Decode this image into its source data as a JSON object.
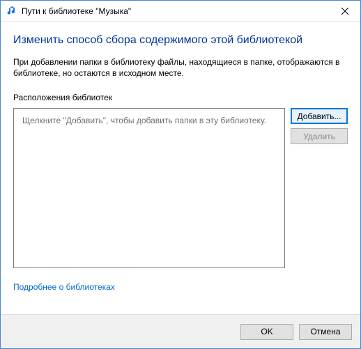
{
  "titlebar": {
    "title": "Пути к библиотеке \"Музыка\""
  },
  "content": {
    "heading": "Изменить способ сбора содержимого этой библиотекой",
    "description": "При добавлении папки в библиотеку файлы, находящиеся в папке, отображаются в библиотеке, но остаются в исходном месте.",
    "list_label": "Расположения библиотек",
    "listbox_placeholder": "Щелкните \"Добавить\", чтобы добавить папки в эту библиотеку."
  },
  "buttons": {
    "add": "Добавить...",
    "remove": "Удалить",
    "ok": "OK",
    "cancel": "Отмена"
  },
  "link": {
    "learn_more": "Подробнее о библиотеках"
  }
}
